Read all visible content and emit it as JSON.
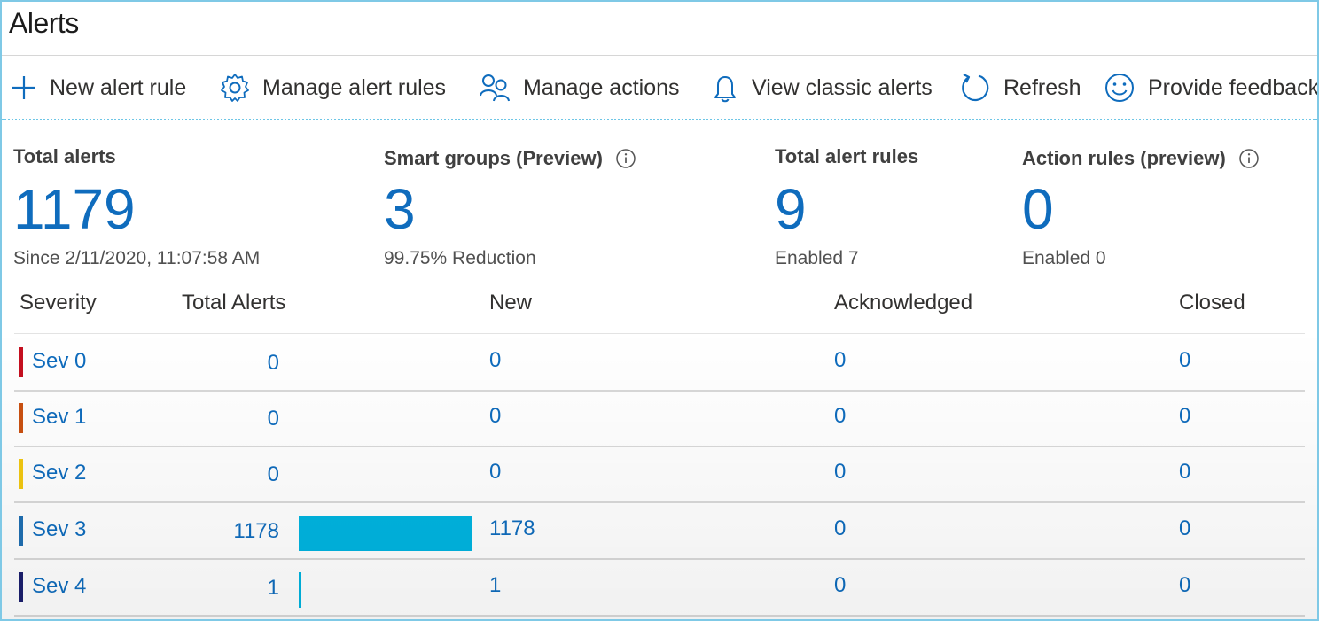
{
  "page": {
    "title": "Alerts"
  },
  "toolbar": {
    "new_alert_rule": "New alert rule",
    "manage_alert_rules": "Manage alert rules",
    "manage_actions": "Manage actions",
    "view_classic_alerts": "View classic alerts",
    "refresh": "Refresh",
    "provide_feedback": "Provide feedback",
    "icons": [
      "plus-icon",
      "gear-icon",
      "people-icon",
      "bell-icon",
      "refresh-icon",
      "smiley-icon"
    ]
  },
  "summary": {
    "total_alerts": {
      "label": "Total alerts",
      "value": "1179",
      "sub": "Since 2/11/2020, 11:07:58 AM"
    },
    "smart_groups": {
      "label": "Smart groups (Preview)",
      "value": "3",
      "sub": "99.75% Reduction"
    },
    "total_alert_rules": {
      "label": "Total alert rules",
      "value": "9",
      "sub": "Enabled 7"
    },
    "action_rules": {
      "label": "Action rules (preview)",
      "value": "0",
      "sub": "Enabled 0"
    }
  },
  "table": {
    "headers": {
      "severity": "Severity",
      "total": "Total Alerts",
      "new": "New",
      "acknowledged": "Acknowledged",
      "closed": "Closed"
    },
    "rows": [
      {
        "severity": "Sev 0",
        "color": "#c50f1f",
        "total": "0",
        "new": "0",
        "acknowledged": "0",
        "closed": "0",
        "bar_fraction": 0
      },
      {
        "severity": "Sev 1",
        "color": "#ca5010",
        "total": "0",
        "new": "0",
        "acknowledged": "0",
        "closed": "0",
        "bar_fraction": 0
      },
      {
        "severity": "Sev 2",
        "color": "#f2c811",
        "total": "0",
        "new": "0",
        "acknowledged": "0",
        "closed": "0",
        "bar_fraction": 0
      },
      {
        "severity": "Sev 3",
        "color": "#1f6fb2",
        "total": "1178",
        "new": "1178",
        "acknowledged": "0",
        "closed": "0",
        "bar_fraction": 1
      },
      {
        "severity": "Sev 4",
        "color": "#1b1f6e",
        "total": "1",
        "new": "1",
        "acknowledged": "0",
        "closed": "0",
        "bar_fraction": 0.0008
      }
    ]
  },
  "colors": {
    "accent": "#0f6cbd",
    "bar": "#00b4e0",
    "frame": "#7fc9e6"
  }
}
